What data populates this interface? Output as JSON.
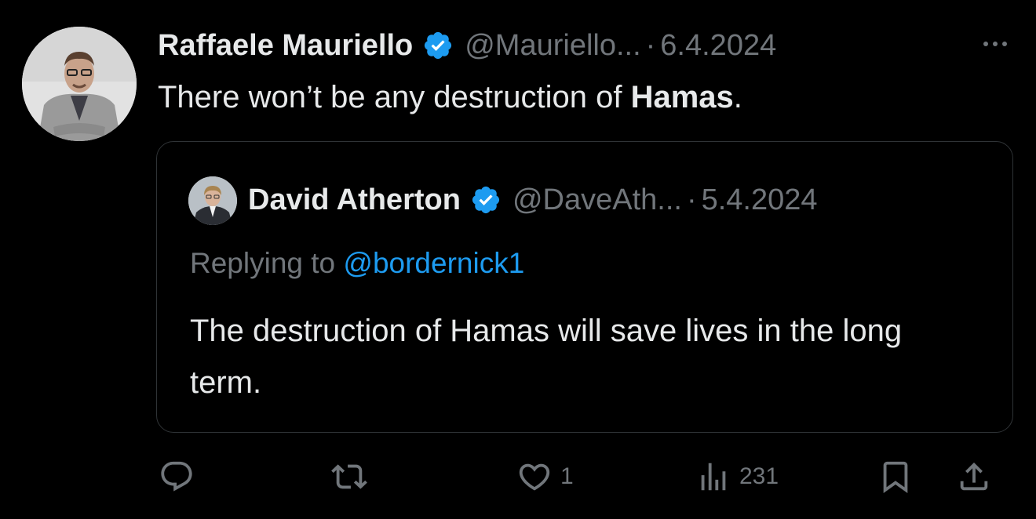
{
  "tweet": {
    "author_name": "Raffaele Mauriello",
    "author_handle": "@Mauriello...",
    "separator": "·",
    "date": "6.4.2024",
    "text_before": "There won’t be any destruction of ",
    "text_bold": "Hamas",
    "text_after": ".",
    "icons": {
      "verified": "verified-badge-icon",
      "more": "more-options-icon"
    }
  },
  "quoted_tweet": {
    "author_name": "David Atherton",
    "author_handle": "@DaveAth...",
    "separator": "·",
    "date": "5.4.2024",
    "replying_prefix": "Replying to ",
    "replying_to": "@bordernick1",
    "text": "The destruction of Hamas will save lives in the long term."
  },
  "actions": {
    "reply_count": "",
    "retweet_count": "",
    "like_count": "1",
    "views_count": "231",
    "icons": [
      "reply-icon",
      "retweet-icon",
      "like-icon",
      "views-icon",
      "bookmark-icon",
      "share-icon"
    ]
  },
  "colors": {
    "background": "#000000",
    "text_primary": "#e7e9ea",
    "text_secondary": "#71767b",
    "accent": "#1d9bf0",
    "border": "#2f3336"
  }
}
